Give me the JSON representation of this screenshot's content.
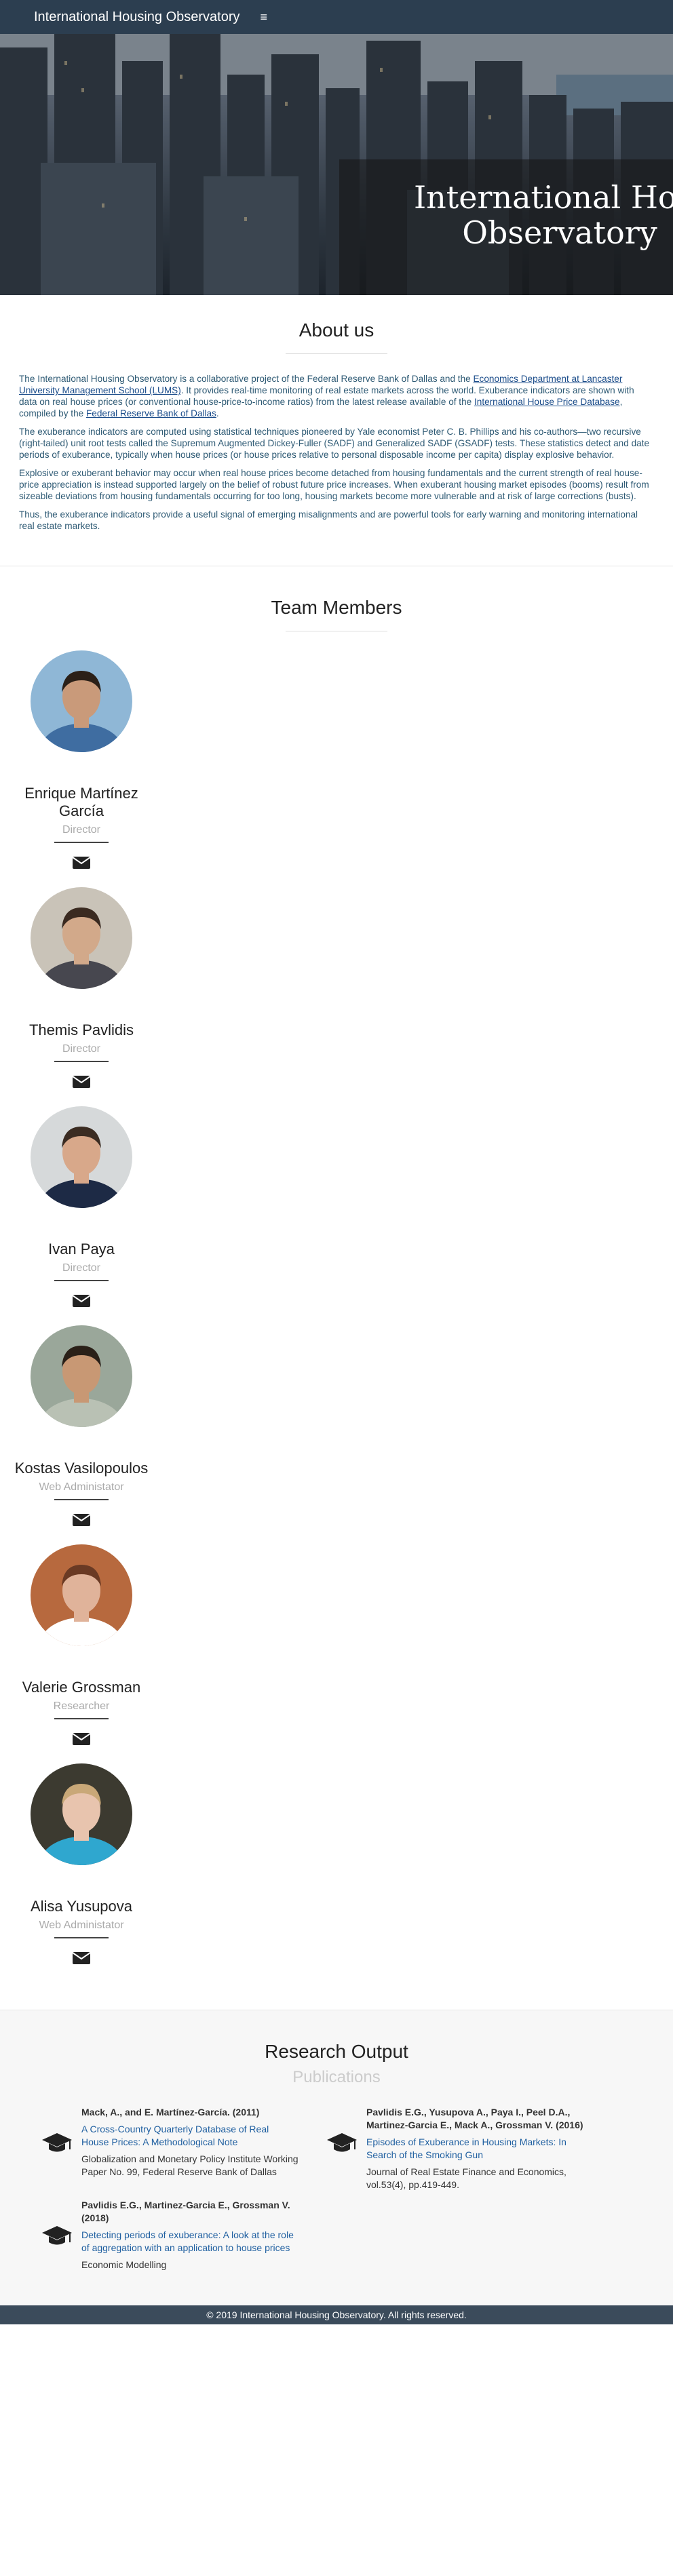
{
  "nav": {
    "brand": "International Housing Observatory",
    "menu_icon": "hamburger-icon"
  },
  "hero": {
    "title_line1": "International Housing",
    "title_line2": "Observatory"
  },
  "about": {
    "title": "About us",
    "p1_a": "The International Housing Observatory is a collaborative project of the Federal Reserve Bank of Dallas and the ",
    "p1_link1": "Economics Department at Lancaster University Management School (LUMS)",
    "p1_b": ". It provides real-time monitoring of real estate markets across the world. Exuberance indicators are shown with data on real house prices (or conventional house-price-to-income ratios) from the latest release available of the ",
    "p1_link2": "International House Price Database",
    "p1_c": ", compiled by the ",
    "p1_link3": "Federal Reserve Bank of Dallas",
    "p1_d": ".",
    "p2": "The exuberance indicators are computed using statistical techniques pioneered by Yale economist Peter C. B. Phillips and his co-authors—two recursive (right-tailed) unit root tests called the Supremum Augmented Dickey-Fuller (SADF) and Generalized SADF (GSADF) tests. These statistics detect and date periods of exuberance, typically when house prices (or house prices relative to personal disposable income per capita) display explosive behavior.",
    "p3": "Explosive or exuberant behavior may occur when real house prices become detached from housing fundamentals and the current strength of real house-price appreciation is instead supported largely on the belief of robust future price increases. When exuberant housing market episodes (booms) result from sizeable deviations from housing fundamentals occurring for too long, housing markets become more vulnerable and at risk of large corrections (busts).",
    "p4": "Thus, the exuberance indicators provide a useful signal of emerging misalignments and are powerful tools for early warning and monitoring international real estate markets."
  },
  "team": {
    "title": "Team Members",
    "members": [
      {
        "name": "Enrique Martínez García",
        "role": "Director",
        "skin": "#c99a7a",
        "hair": "#2b2018",
        "shirt": "#3f6da1",
        "bg": "#8fb7d6"
      },
      {
        "name": "Themis Pavlidis",
        "role": "Director",
        "skin": "#d2a98a",
        "hair": "#3a2a20",
        "shirt": "#47474f",
        "bg": "#c9c3b8"
      },
      {
        "name": "Ivan Paya",
        "role": "Director",
        "skin": "#d8a88a",
        "hair": "#3b2c22",
        "shirt": "#1d2a45",
        "bg": "#d6d9da"
      },
      {
        "name": "Kostas Vasilopoulos",
        "role": "Web Administator",
        "skin": "#c89874",
        "hair": "#2a2018",
        "shirt": "#b9c1b4",
        "bg": "#9aa79a"
      },
      {
        "name": "Valerie Grossman",
        "role": "Researcher",
        "skin": "#e0b39a",
        "hair": "#6a3a24",
        "shirt": "#ffffff",
        "bg": "#b7693e"
      },
      {
        "name": "Alisa Yusupova",
        "role": "Web Administator",
        "skin": "#e8c4ae",
        "hair": "#c9a878",
        "shirt": "#2fa7cf",
        "bg": "#3c3a30"
      }
    ]
  },
  "research": {
    "title": "Research Output",
    "subtitle": "Publications",
    "pubs": [
      {
        "authors": "Mack, A., and E. Martínez-García. (2011)",
        "title": " A Cross-Country Quarterly Database of Real House Prices: A Methodological Note",
        "venue": "Globalization and Monetary Policy Institute Working Paper No. 99, Federal Reserve Bank of Dallas"
      },
      {
        "authors": "Pavlidis E.G., Martinez-Garcia E., Grossman V. (2018)",
        "title": " Detecting periods of exuberance: A look at the role of aggregation with an application to house prices",
        "venue": "Economic Modelling"
      },
      {
        "authors": "Pavlidis E.G., Yusupova A., Paya I., Peel D.A., Martinez-Garcia E., Mack A., Grossman V. (2016)",
        "title": " Episodes of Exuberance in Housing Markets: In Search of the Smoking Gun",
        "venue": "Journal of Real Estate Finance and Economics, vol.53(4), pp.419-449."
      }
    ]
  },
  "footer": {
    "text": "© 2019 International Housing Observatory. All rights reserved."
  }
}
